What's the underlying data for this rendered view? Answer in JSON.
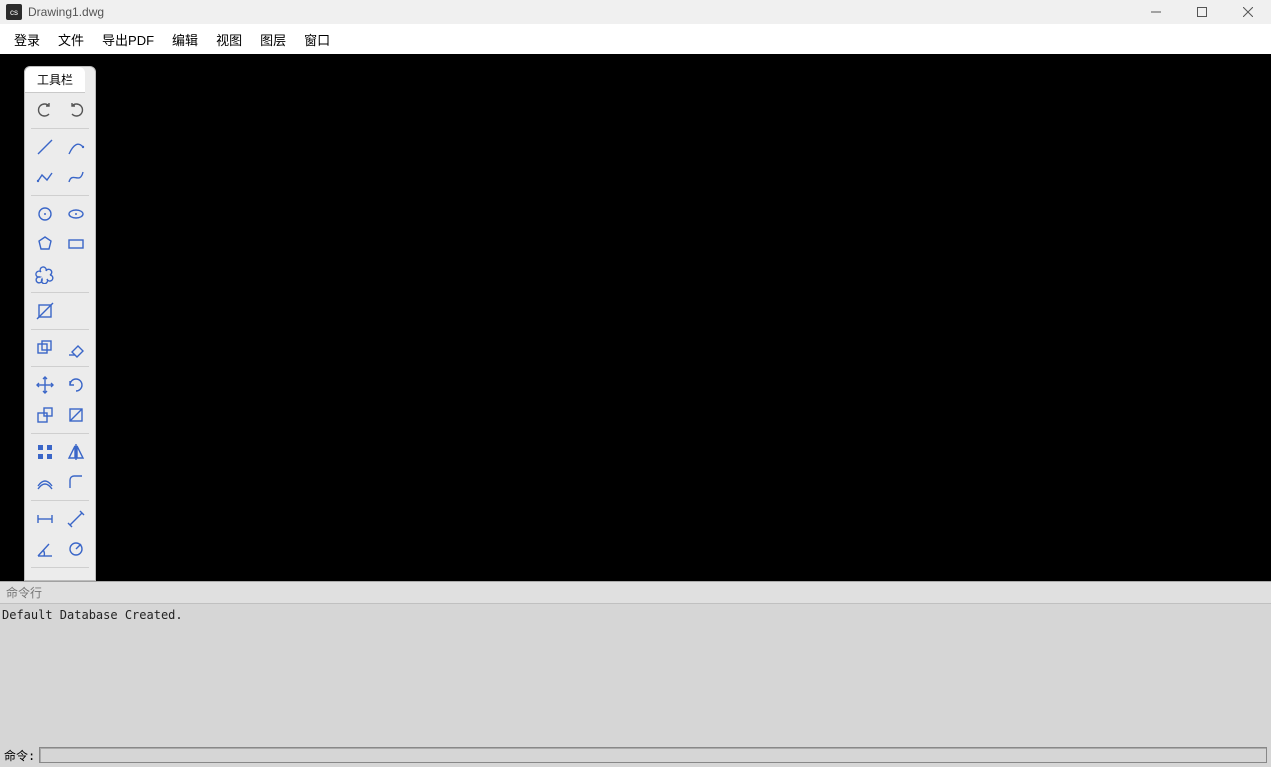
{
  "window": {
    "title": "Drawing1.dwg",
    "app_icon_text": "cs"
  },
  "menu": {
    "items": [
      "登录",
      "文件",
      "导出PDF",
      "编辑",
      "视图",
      "图层",
      "窗口"
    ]
  },
  "toolbox": {
    "title": "工具栏"
  },
  "command_panel": {
    "header": "命令行",
    "log": "Default Database Created.",
    "prompt": "命令:",
    "input_value": ""
  }
}
